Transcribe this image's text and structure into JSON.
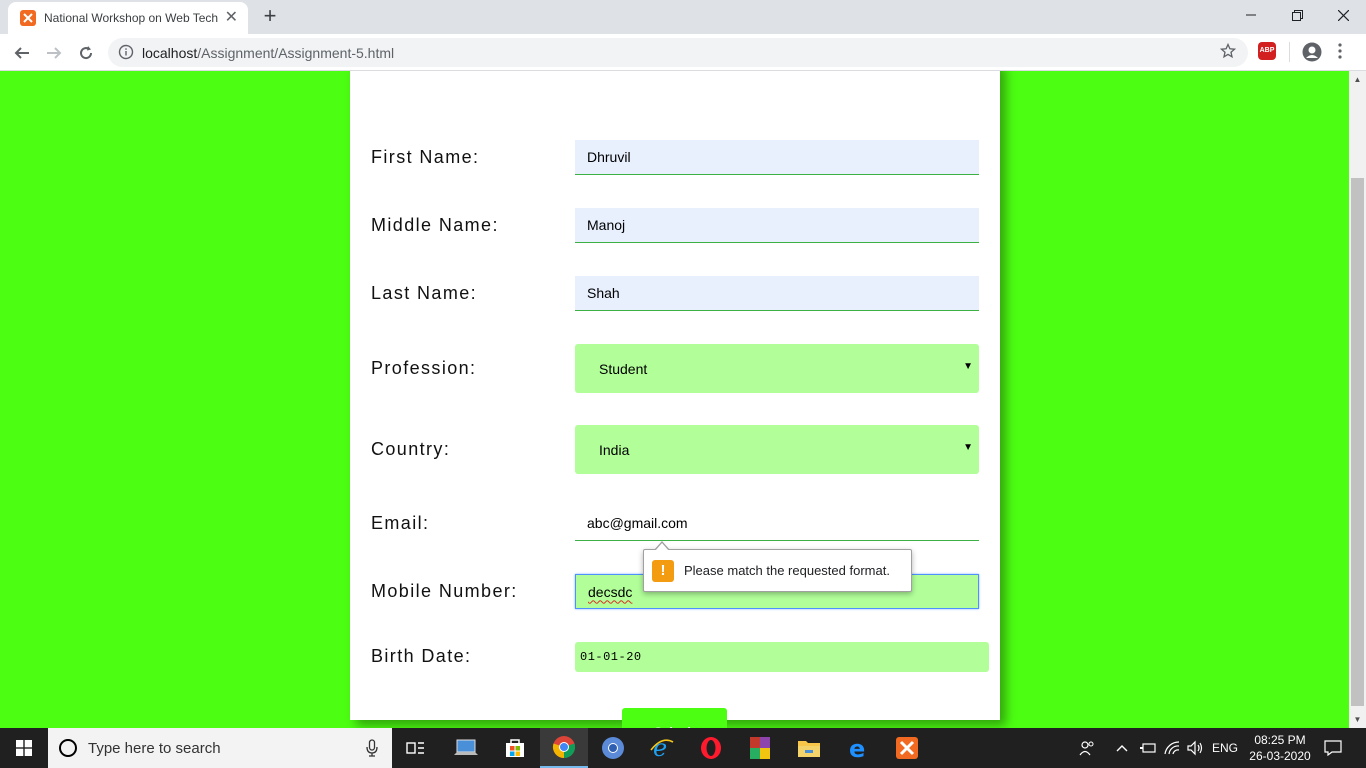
{
  "browser": {
    "tab_title": "National Workshop on Web Tech",
    "tab_close": "✕",
    "new_tab": "+",
    "url_host": "localhost",
    "url_path": "/Assignment/Assignment-5.html",
    "extension": "ABP"
  },
  "form": {
    "first_name": {
      "label": "First Name:",
      "value": "Dhruvil"
    },
    "middle_name": {
      "label": "Middle Name:",
      "value": "Manoj"
    },
    "last_name": {
      "label": "Last Name:",
      "value": "Shah"
    },
    "profession": {
      "label": "Profession:",
      "value": "Student"
    },
    "country": {
      "label": "Country:",
      "value": "India"
    },
    "email": {
      "label": "Email:",
      "value": "abc@gmail.com"
    },
    "mobile": {
      "label": "Mobile Number:",
      "value": "decsdc"
    },
    "birth_date": {
      "label": "Birth Date:",
      "value": "01-01-20"
    },
    "submit_label": "Submit"
  },
  "validation": {
    "icon": "!",
    "message": "Please match the requested format."
  },
  "taskbar": {
    "search_placeholder": "Type here to search",
    "language": "ENG",
    "time": "08:25 PM",
    "date": "26-03-2020"
  },
  "colors": {
    "page_background": "#4cff12",
    "select_background": "#b2ff9a",
    "autofill_background": "#e8f0fe",
    "warning": "#f39c12"
  }
}
